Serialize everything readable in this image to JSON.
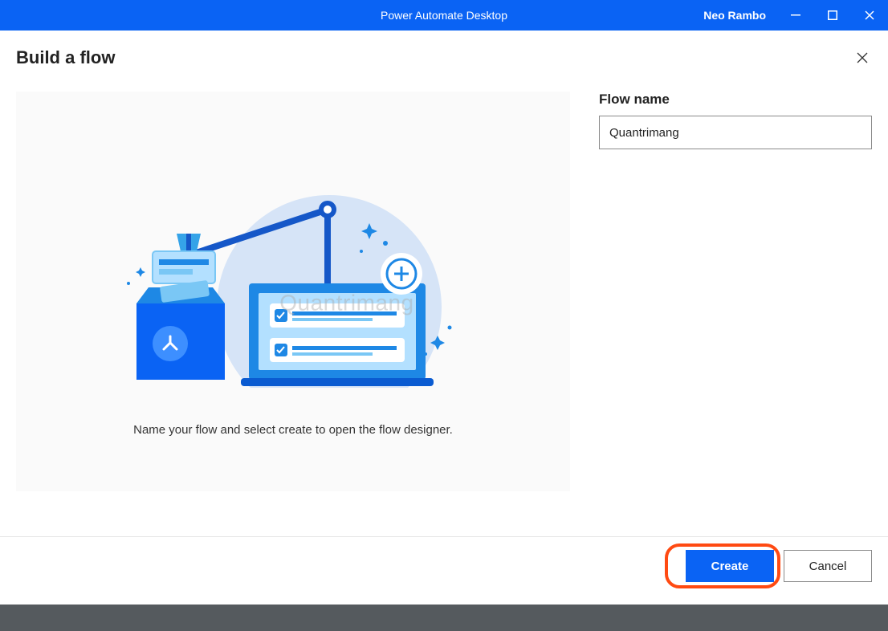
{
  "titlebar": {
    "app_title": "Power Automate Desktop",
    "user": "Neo Rambo"
  },
  "dialog": {
    "title": "Build a flow",
    "description": "Name your flow and select create to open the flow designer."
  },
  "form": {
    "flow_name_label": "Flow name",
    "flow_name_value": "Quantrimang"
  },
  "buttons": {
    "create": "Create",
    "cancel": "Cancel"
  },
  "watermark": "Quantrimang",
  "colors": {
    "accent": "#0a63f4",
    "highlight": "#ff4a12"
  }
}
